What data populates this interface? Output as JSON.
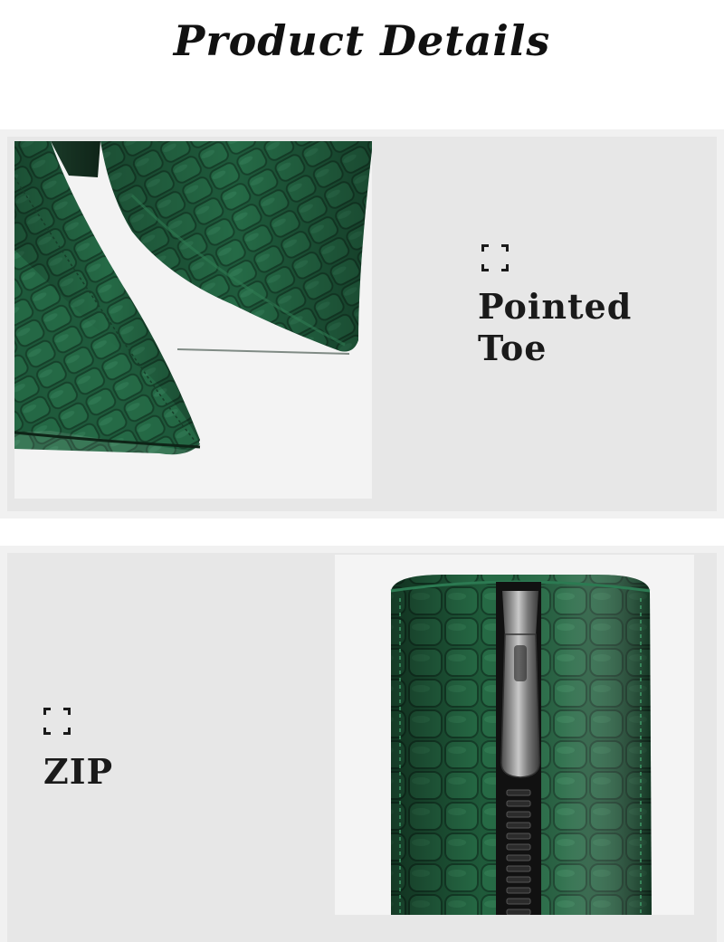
{
  "title": "Product Details",
  "features": [
    {
      "label_line1": "Pointed",
      "label_line2": "Toe",
      "icon": "focus-corners-icon"
    },
    {
      "label_line1": "ZIP",
      "icon": "focus-corners-icon"
    }
  ],
  "colors": {
    "leather_green": "#1f5a3a",
    "panel_background": "#e7e7e7",
    "text": "#111111"
  }
}
